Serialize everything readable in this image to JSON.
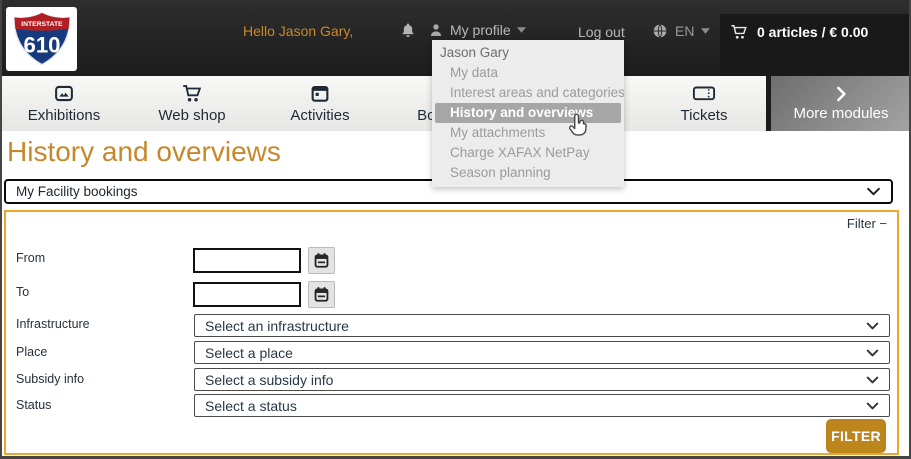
{
  "colors": {
    "accent_gold": "#c8882a",
    "button_gold": "#bc861d",
    "panel_border_gold": "#f0a42c",
    "header_bg": "#262626",
    "menu_highlight_gray": "#a6a6a6",
    "nav_text": "#1e2a36"
  },
  "icons": {
    "caret_down_glyph": "▾",
    "collapse_minus_glyph": "−",
    "chevron_right_glyph": "›",
    "named": [
      "interstate-shield-logo",
      "bell-icon",
      "person-icon",
      "globe-icon",
      "cart-icon",
      "image-icon",
      "shop-cart-icon",
      "calendar-icon",
      "ticket-icon",
      "chevron-right-icon",
      "chevron-down-icon",
      "hand-pointer-cursor"
    ]
  },
  "header": {
    "logo": {
      "top_text": "INTERSTATE",
      "number": "610"
    },
    "greeting": "Hello Jason Gary,",
    "profile_label": "My profile",
    "logout_label": "Log out",
    "language_code": "EN",
    "cart_summary": "0 articles / € 0.00"
  },
  "profile_menu": {
    "items": [
      {
        "label": "Jason Gary"
      },
      {
        "label": "My data"
      },
      {
        "label": "Interest areas and categories"
      },
      {
        "label": "History and overviews",
        "active": true
      },
      {
        "label": "My attachments"
      },
      {
        "label": "Charge XAFAX NetPay"
      },
      {
        "label": "Season planning"
      }
    ]
  },
  "nav": {
    "items": [
      {
        "label": "Exhibitions"
      },
      {
        "label": "Web shop"
      },
      {
        "label": "Activities"
      },
      {
        "label": "Bookings"
      },
      {
        "label": "Tickets"
      }
    ],
    "more_modules_label": "More modules"
  },
  "page": {
    "title": "History and overviews",
    "view_selector_value": "My Facility bookings"
  },
  "filter_panel": {
    "toggle_label": "Filter",
    "collapse_glyph": "−",
    "from_label": "From",
    "to_label": "To",
    "infrastructure_label": "Infrastructure",
    "infrastructure_value": "Select an infrastructure",
    "place_label": "Place",
    "place_value": "Select a place",
    "subsidy_label": "Subsidy info",
    "subsidy_value": "Select a subsidy info",
    "status_label": "Status",
    "status_value": "Select a status",
    "submit_label": "FILTER"
  }
}
